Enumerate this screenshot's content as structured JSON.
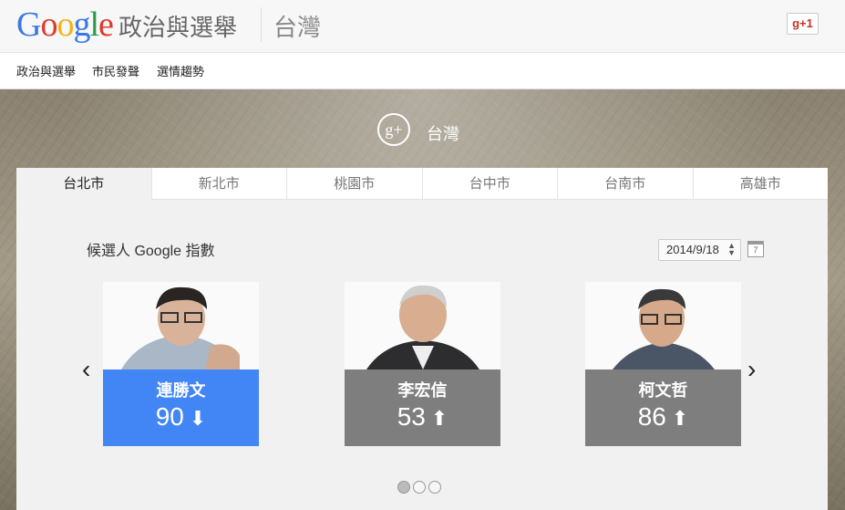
{
  "header": {
    "logo_parts": [
      "G",
      "o",
      "o",
      "g",
      "l",
      "e"
    ],
    "site_title": "政治與選舉",
    "region_title": "台灣",
    "gplus_label": "g+1"
  },
  "nav": {
    "items": [
      "政治與選舉",
      "市民發聲",
      "選情趨勢"
    ]
  },
  "hero": {
    "icon_label": "g+",
    "label": "台灣"
  },
  "tabs": [
    "台北市",
    "新北市",
    "桃園市",
    "台中市",
    "台南市",
    "高雄市"
  ],
  "active_tab": "台北市",
  "section": {
    "title": "候選人 Google 指數",
    "date": "2014/9/18",
    "calendar_day": "7"
  },
  "candidates": [
    {
      "name": "連勝文",
      "score": "90",
      "trend": "down",
      "trend_glyph": "⬇",
      "color": "#4285f4"
    },
    {
      "name": "李宏信",
      "score": "53",
      "trend": "up",
      "trend_glyph": "⬆",
      "color": "#7e7e7e"
    },
    {
      "name": "柯文哲",
      "score": "86",
      "trend": "up",
      "trend_glyph": "⬆",
      "color": "#7e7e7e"
    }
  ],
  "carousel": {
    "prev_glyph": "‹",
    "next_glyph": "›",
    "pages": 3,
    "active_page": 1
  }
}
